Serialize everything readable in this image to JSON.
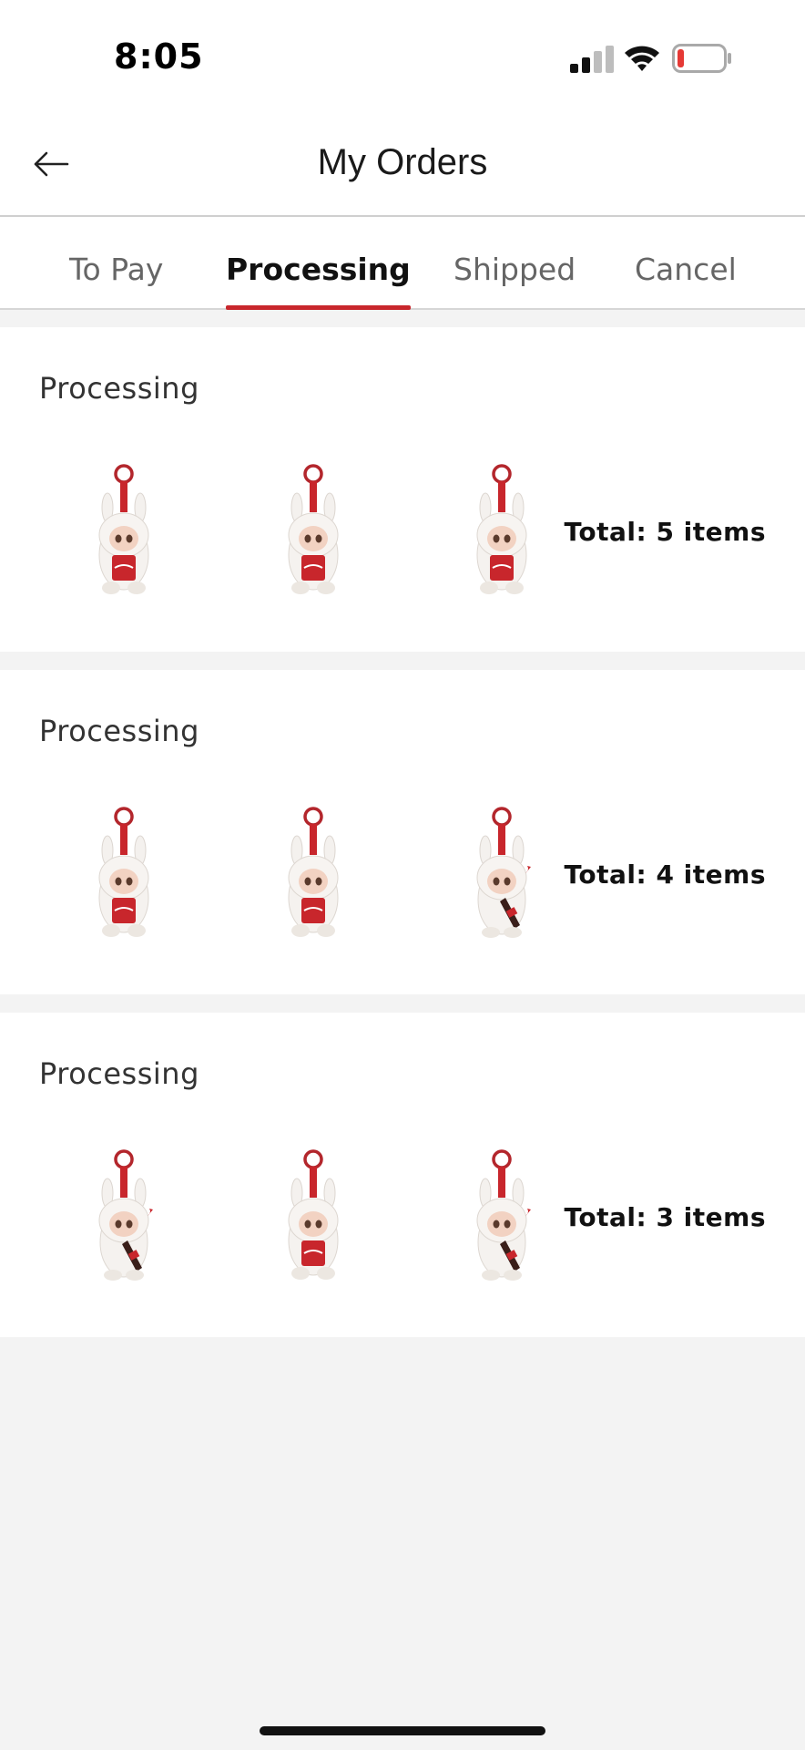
{
  "status_bar": {
    "time": "8:05",
    "icons": [
      "cellular-signal-icon",
      "wifi-icon",
      "battery-low-icon"
    ],
    "battery_color": "#e53935"
  },
  "header": {
    "title": "My Orders",
    "back_icon": "arrow-left-icon"
  },
  "tabs": [
    {
      "label": "To Pay",
      "active": false
    },
    {
      "label": "Processing",
      "active": true
    },
    {
      "label": "Shipped",
      "active": false
    },
    {
      "label": "Cancel",
      "active": false
    }
  ],
  "accent_color": "#c8262c",
  "orders": [
    {
      "status": "Processing",
      "total": "Total: 5 items",
      "thumbnails": [
        "plush-keychain-can-icon",
        "plush-keychain-can-icon",
        "plush-keychain-can-icon"
      ]
    },
    {
      "status": "Processing",
      "total": "Total: 4 items",
      "thumbnails": [
        "plush-keychain-can-icon",
        "plush-keychain-can-icon",
        "plush-keychain-bottle-icon"
      ]
    },
    {
      "status": "Processing",
      "total": "Total: 3 items",
      "thumbnails": [
        "plush-keychain-bottle-icon",
        "plush-keychain-can-icon",
        "plush-keychain-bottle-icon"
      ]
    }
  ]
}
